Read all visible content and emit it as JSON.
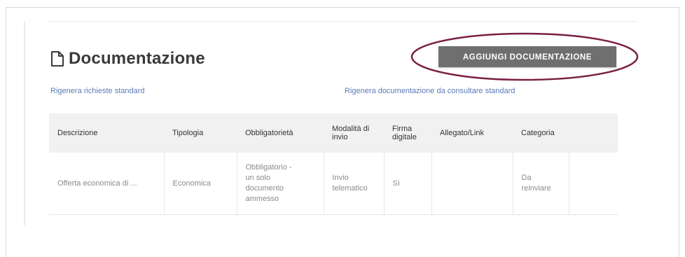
{
  "section": {
    "title": "Documentazione",
    "add_button_label": "AGGIUNGI DOCUMENTAZIONE"
  },
  "links": {
    "regenerate_requests": "Rigenera richieste standard",
    "regenerate_docs": "Rigenera documentazione da consultare standard"
  },
  "table": {
    "headers": {
      "descrizione": "Descrizione",
      "tipologia": "Tipologia",
      "obbligatorieta": "Obbligatorietà",
      "modalita": "Modalità di invio",
      "firma": "Firma digitale",
      "allegato": "Allegato/Link",
      "categoria": "Categoria"
    },
    "rows": [
      {
        "descrizione": "Offerta economica di ...",
        "tipologia": "Economica",
        "obbligatorieta": "Obbligatorio - un solo documento ammesso",
        "modalita": "Invio telematico",
        "firma": "Sì",
        "allegato": "",
        "categoria": "Da reinviare"
      }
    ]
  },
  "colors": {
    "button_bg": "#6f6f6f",
    "link": "#5a7ab8",
    "highlight_ellipse": "#7a1f45",
    "header_bg": "#f1f1f1"
  }
}
